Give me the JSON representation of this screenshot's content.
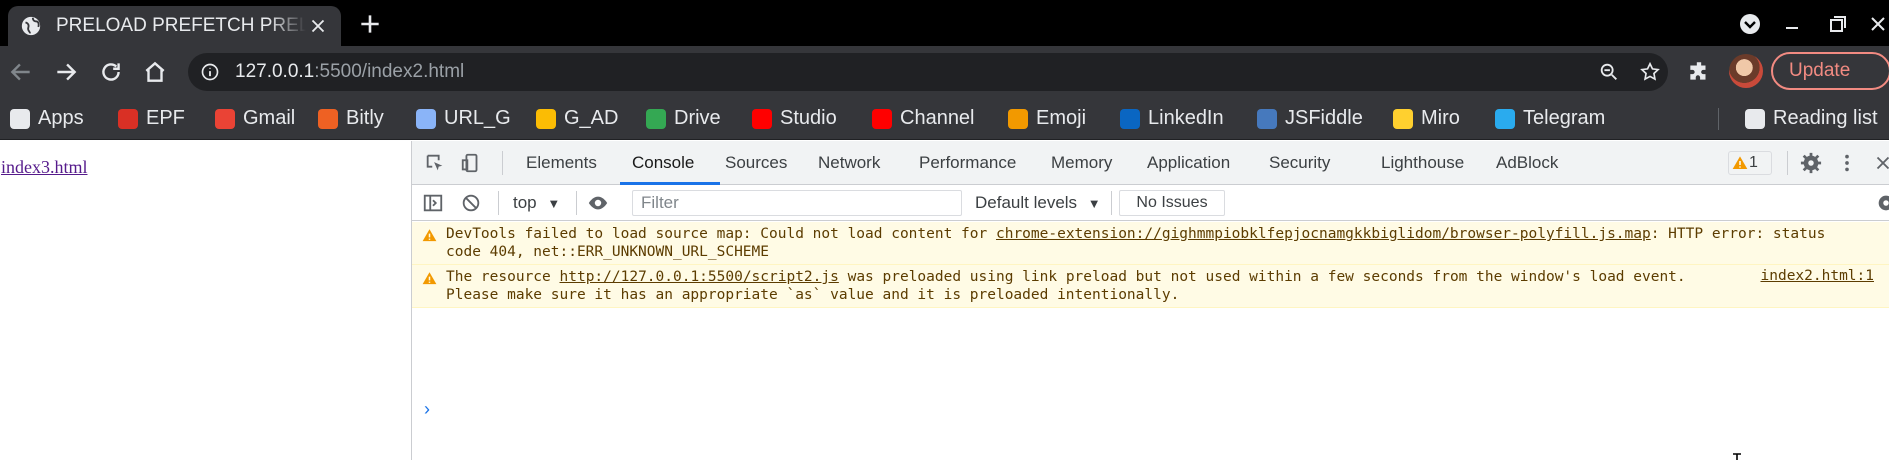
{
  "browser": {
    "tab_title": "PRELOAD PREFETCH PRELOAD",
    "url_host": "127.0.0.1",
    "url_rest": ":5500/index2.html",
    "update_label": "Update"
  },
  "bookmarks": [
    {
      "label": "Apps",
      "icon": "apps-grid-icon",
      "color": "#e8eaed"
    },
    {
      "label": "EPF",
      "icon": "epf-icon",
      "color": "#d93025"
    },
    {
      "label": "Gmail",
      "icon": "gmail-icon",
      "color": "#ea4335"
    },
    {
      "label": "Bitly",
      "icon": "bitly-icon",
      "color": "#ee6123"
    },
    {
      "label": "URL_G",
      "icon": "url-g-icon",
      "color": "#8ab4f8"
    },
    {
      "label": "G_AD",
      "icon": "google-ads-icon",
      "color": "#fbbc04"
    },
    {
      "label": "Drive",
      "icon": "drive-icon",
      "color": "#34a853"
    },
    {
      "label": "Studio",
      "icon": "youtube-studio-icon",
      "color": "#ff0000"
    },
    {
      "label": "Channel",
      "icon": "youtube-icon",
      "color": "#ff0000"
    },
    {
      "label": "Emoji",
      "icon": "emoji-icon",
      "color": "#f29900"
    },
    {
      "label": "LinkedIn",
      "icon": "linkedin-icon",
      "color": "#0a66c2"
    },
    {
      "label": "JSFiddle",
      "icon": "jsfiddle-icon",
      "color": "#4679bd"
    },
    {
      "label": "Miro",
      "icon": "miro-icon",
      "color": "#ffd02f"
    },
    {
      "label": "Telegram",
      "icon": "telegram-icon",
      "color": "#2aabee"
    },
    {
      "label": "Reading list",
      "icon": "reading-list-icon",
      "color": "#e8eaed"
    }
  ],
  "page": {
    "link_text": "index3.html"
  },
  "devtools": {
    "tabs": [
      "Elements",
      "Console",
      "Sources",
      "Network",
      "Performance",
      "Memory",
      "Application",
      "Security",
      "Lighthouse",
      "AdBlock"
    ],
    "active_tab": "Console",
    "warning_count": "1",
    "context": "top",
    "filter_placeholder": "Filter",
    "levels_label": "Default levels",
    "issues_label": "No Issues",
    "messages": [
      {
        "type": "warning",
        "text_before": "DevTools failed to load source map: Could not load content for ",
        "link": "chrome-extension://gighmmpiobklfepjocnamgkkbiglidom/browser-polyfill.js.map",
        "text_after": ": HTTP error: status code 404, net::ERR_UNKNOWN_URL_SCHEME",
        "source": ""
      },
      {
        "type": "warning",
        "text_before": "The resource ",
        "link": "http://127.0.0.1:5500/script2.js",
        "text_after": " was preloaded using link preload but not used within a few seconds from the window's load event. Please make sure it has an appropriate `as` value and it is preloaded intentionally.",
        "source": "index2.html:1"
      }
    ],
    "prompt_symbol": "›"
  },
  "colors": {
    "accent": "#1a73e8",
    "warning_bg": "#fffbe5",
    "warning_text": "#5c3c00",
    "update_red": "#f28b82"
  }
}
